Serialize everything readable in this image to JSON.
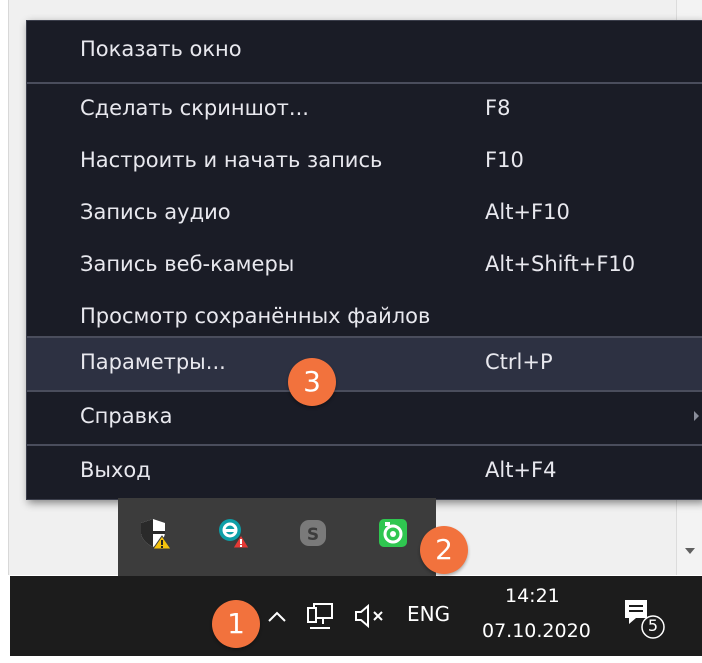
{
  "context_menu": {
    "items": [
      {
        "label": "Показать окно",
        "shortcut": ""
      },
      {
        "label": "Сделать скриншот...",
        "shortcut": "F8"
      },
      {
        "label": "Настроить и начать запись",
        "shortcut": "F10"
      },
      {
        "label": "Запись аудио",
        "shortcut": "Alt+F10"
      },
      {
        "label": "Запись веб-камеры",
        "shortcut": "Alt+Shift+F10"
      },
      {
        "label": "Просмотр сохранённых файлов",
        "shortcut": ""
      },
      {
        "label": "Параметры...",
        "shortcut": "Ctrl+P"
      },
      {
        "label": "Справка",
        "shortcut": ""
      },
      {
        "label": "Выход",
        "shortcut": "Alt+F4"
      }
    ],
    "highlighted_item": "Параметры..."
  },
  "tray_overflow": {
    "icons": [
      "security-warning-icon",
      "antivirus-alert-icon",
      "skype-icon",
      "screen-recorder-icon"
    ]
  },
  "taskbar": {
    "language": "ENG",
    "time": "14:21",
    "date": "07.10.2020",
    "notification_count": "5",
    "icons": [
      "show-hidden-icons-chevron-icon",
      "network-icon",
      "volume-muted-icon",
      "action-center-icon"
    ]
  },
  "callouts": [
    "1",
    "2",
    "3"
  ],
  "colors": {
    "menu_bg": "#1a1c26",
    "menu_highlight": "#2d3142",
    "callout": "#f2723d",
    "taskbar_bg": "#1c1c1c"
  }
}
